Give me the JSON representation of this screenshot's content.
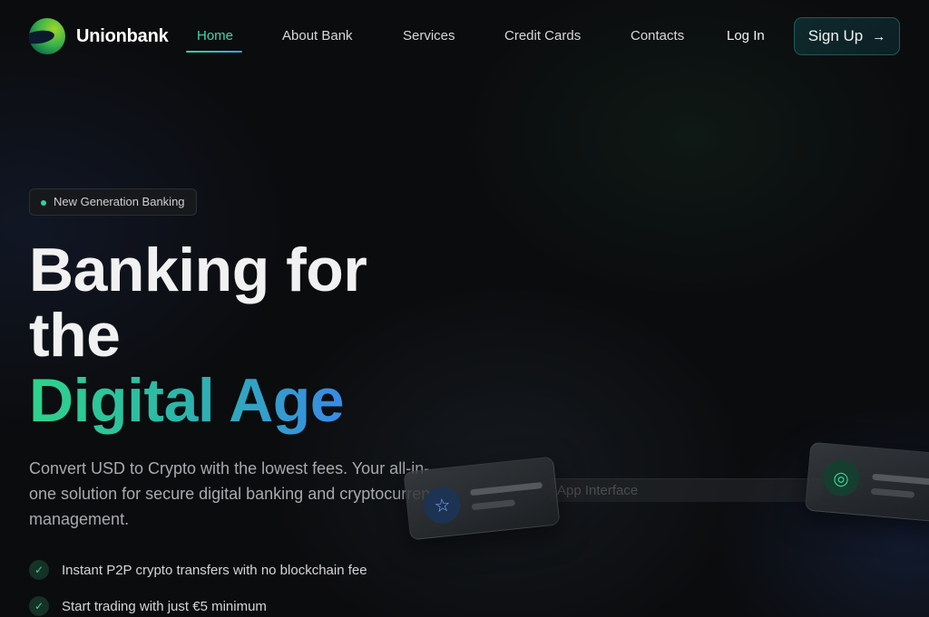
{
  "brand": {
    "name": "Unionbank"
  },
  "nav": {
    "items": [
      {
        "label": "Home",
        "active": true
      },
      {
        "label": "About Bank"
      },
      {
        "label": "Services"
      },
      {
        "label": "Credit Cards"
      },
      {
        "label": "Contacts"
      }
    ],
    "login_label": "Log In",
    "signup_label": "Sign Up"
  },
  "hero": {
    "badge": "New Generation Banking",
    "title_line1": "Banking for",
    "title_line2": "the",
    "title_highlight": "Digital Age",
    "subtitle": "Convert USD to Crypto with the lowest fees. Your all-in-one solution for secure digital banking and cryptocurrency management.",
    "features": [
      "Instant P2P crypto transfers with no blockchain fee",
      "Start trading with just €5 minimum"
    ]
  },
  "illustration": {
    "placeholder_text": "App Interface"
  },
  "colors": {
    "accent_green": "#2fd39a",
    "accent_blue": "#3a8ae6",
    "background": "#0b0c0e"
  },
  "icons": {
    "signup": "arrow-right-icon",
    "feature": "check-icon",
    "card_left": "star-icon",
    "card_right": "target-icon"
  }
}
